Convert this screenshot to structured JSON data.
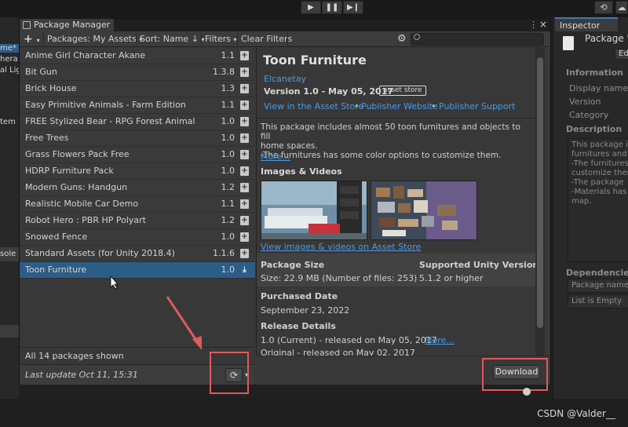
{
  "colors": {
    "accent_link": "#4c9ae6",
    "selected_row": "#2c5d87",
    "annotation_red": "#e05a5a"
  },
  "toolbar_top": {
    "play_icon": "play-icon",
    "pause_icon": "pause-icon",
    "step_icon": "step-icon",
    "history_icon": "history-icon",
    "cloud_icon": "cloud-icon"
  },
  "left_edge": {
    "texts": [
      "me*",
      "hera",
      "al Lig",
      "tem",
      "sole"
    ]
  },
  "inspector": {
    "tab_label": "Inspector",
    "package_label": "Package 'T",
    "edit_label": "Edi",
    "information_head": "Information",
    "display_name": "Display name",
    "version": "Version",
    "category": "Category",
    "description_head": "Description",
    "description_text": "This package i\nfurnitures and c\n-The furnitures\ncustomize them\n-The package\n-Materials has\nmap.",
    "dependencies_head": "Dependencies",
    "package_name_row": "Package name",
    "list_empty": "List is Empty",
    "edge_number": "6"
  },
  "pm": {
    "window_title": "Package Manager",
    "menu_icon": "kebab-menu-icon",
    "close_icon": "×",
    "toolbar": {
      "add_label": "+",
      "packages_label": "Packages: My Assets",
      "sort_label": "Sort: Name ↓",
      "filters_label": "Filters",
      "clear_filters_label": "Clear Filters",
      "settings_icon": "gear-icon",
      "search_placeholder": ""
    },
    "packages": [
      {
        "name": "Anime Girl Character Akane",
        "version": "1.1"
      },
      {
        "name": "Bit Gun",
        "version": "1.3.8"
      },
      {
        "name": "Brick House",
        "version": "1.3"
      },
      {
        "name": "Easy Primitive Animals - Farm Edition",
        "version": "1.1"
      },
      {
        "name": "FREE Stylized Bear - RPG Forest Animal",
        "version": "1.0"
      },
      {
        "name": "Free Trees",
        "version": "1.0"
      },
      {
        "name": "Grass Flowers Pack Free",
        "version": "1.0"
      },
      {
        "name": "HDRP Furniture Pack",
        "version": "1.0"
      },
      {
        "name": "Modern Guns: Handgun",
        "version": "1.2"
      },
      {
        "name": "Realistic Mobile Car Demo",
        "version": "1.1"
      },
      {
        "name": "Robot Hero : PBR HP Polyart",
        "version": "1.2"
      },
      {
        "name": "Snowed Fence",
        "version": "1.0"
      },
      {
        "name": "Standard Assets (for Unity 2018.4)",
        "version": "1.1.6"
      },
      {
        "name": "Toon Furniture",
        "version": "1.0",
        "selected": true
      }
    ],
    "list_count": "All 14 packages shown",
    "last_update": "Last update Oct 11, 15:31",
    "refresh_icon": "⟳",
    "details": {
      "title": "Toon Furniture",
      "author": "Elcanetay",
      "version_line": "Version 1.0 - May 05, 2017",
      "badge": "asset store",
      "link_asset_store": "View in the Asset Store",
      "link_publisher_website": "Publisher Website",
      "link_publisher_support": "Publisher Support",
      "description": "This package includes almost 50 toon furnitures and objects to fill\nhome spaces.\n-The furnitures has some color options to customize them.",
      "more_label": "More...",
      "images_head": "Images & Videos",
      "view_images_label": "View images & videos on Asset Store",
      "package_size_head": "Package Size",
      "package_size_value": "Size: 22.9 MB (Number of files: 253)",
      "supported_head": "Supported Unity Versions",
      "supported_value": "5.1.2 or higher",
      "purchased_head": "Purchased Date",
      "purchased_value": "September 23, 2022",
      "release_head": "Release Details",
      "release_current": "1.0 (Current) - released on May 05, 2017",
      "release_more": "More...",
      "release_original": "Original - released on May 02, 2017",
      "download_label": "Download"
    }
  },
  "watermark": "CSDN @Valder__"
}
